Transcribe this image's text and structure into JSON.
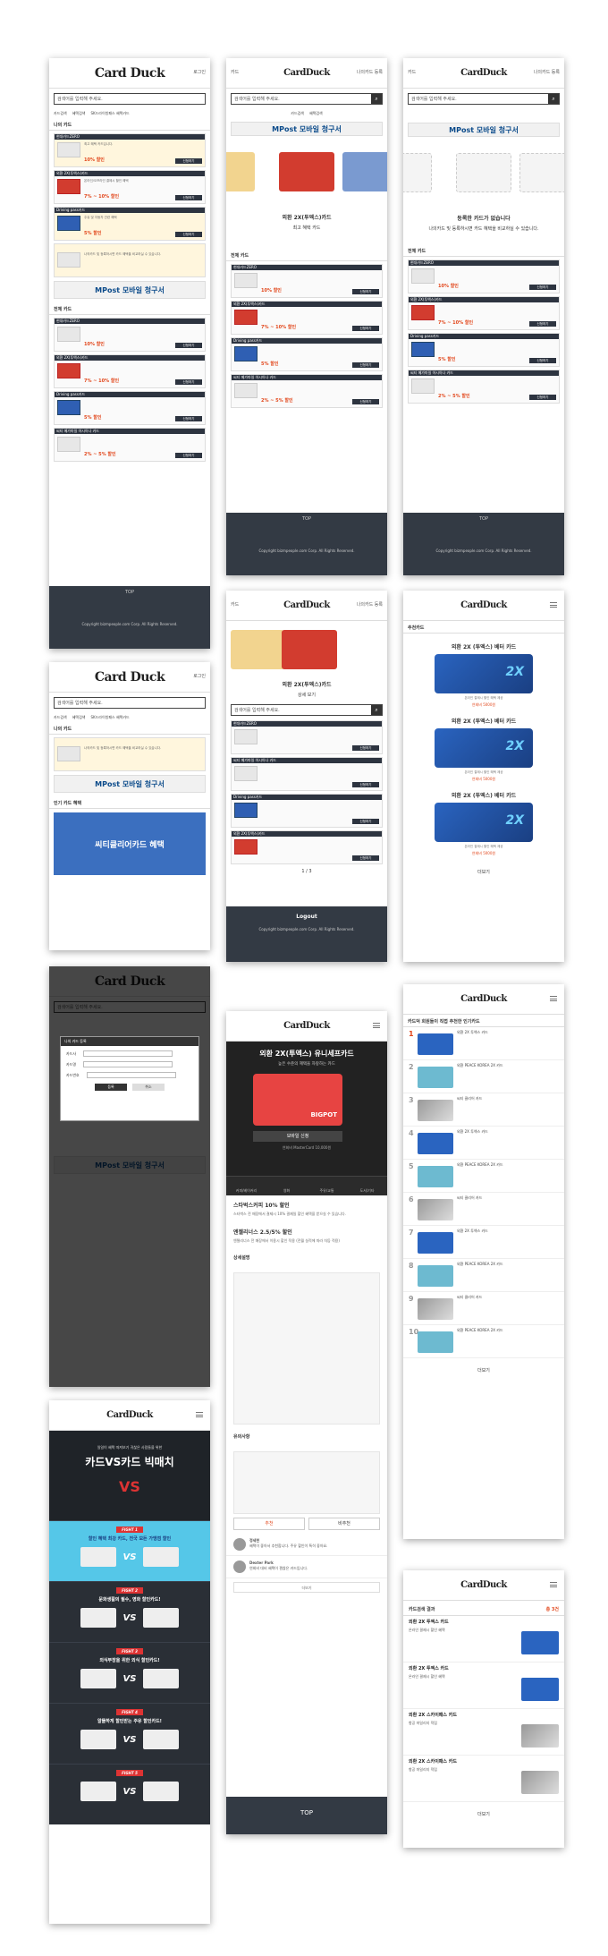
{
  "brand": {
    "logo": "Card Duck",
    "logo_small": "CardDuck"
  },
  "header": {
    "login": "로그인",
    "nav_left": "카드",
    "nav_right": "나의카드 등록"
  },
  "search": {
    "placeholder": "검색어를 입력해 주세요."
  },
  "chips": [
    "카드검색",
    "혜택검색",
    "SK드라이빙패스 혜택카드"
  ],
  "sections": {
    "my_card": "나의 카드",
    "all_card": "전체 카드",
    "popular_benefit": "인기 카드 혜택",
    "registered": "등록한 카드가 없습니다",
    "add_desc": "나의카드 및 등록하시면 카드 혜택을 비교하실 수 있습니다."
  },
  "cards": [
    {
      "bar": "현대카드ZERO",
      "desc": "최고 혜택 카드입니다.",
      "discount": "10% 할인",
      "apply": "신청하기"
    },
    {
      "bar": "외환 2X(투엑스)카드",
      "desc": "온라인/오프라인 결제시 할인 혜택",
      "discount": "7% ~ 10% 할인",
      "apply": "신청하기"
    },
    {
      "bar": "Driving pass카드",
      "desc": "주유 및 자동차 관련 혜택",
      "discount": "5% 할인",
      "apply": "신청하기"
    },
    {
      "bar": "씨티 메가마일 아시아나 카드",
      "desc": "아시아나 클럽 마일 적립",
      "discount": "2% ~ 5% 할인",
      "apply": "신청하기"
    }
  ],
  "banner": {
    "text": "MPost 모바일 청구서",
    "promo": "씨티클리어카드 혜택"
  },
  "footer": {
    "top": "TOP",
    "copy": "Copyright bizmpeople.com Corp. All Rights Reserved.",
    "logout": "Logout"
  },
  "slider": {
    "card_name": "외환 2X(투엑스)카드",
    "card_sub": "최고 혜택 카드",
    "page": "1 / 3",
    "detail_btn": "상세 보기"
  },
  "modal": {
    "title": "나의 카드 등록",
    "fields": [
      "카드사",
      "카드명",
      "카드번호"
    ],
    "ok": "등록",
    "cancel": "취소"
  },
  "recommend": {
    "section": "추천카드",
    "items": [
      {
        "title": "외환 2X (투엑스) 베터 카드",
        "desc": "온라인 결제시 할인 혜택 제공",
        "price": "연회비 5000원"
      },
      {
        "title": "외환 2X (투엑스) 베터 카드",
        "desc": "온라인 결제시 할인 혜택 제공",
        "price": "연회비 5000원"
      },
      {
        "title": "외환 2X (투엑스) 베터 카드",
        "desc": "온라인 결제시 할인 혜택 제공",
        "price": "연회비 5000원"
      }
    ],
    "more": "더보기"
  },
  "ranking": {
    "title": "카드덕 회원들이 직접 추천한 인기카드",
    "items": [
      {
        "n": "1",
        "name": "외환 2X 투엑스 카드",
        "tone": "b"
      },
      {
        "n": "2",
        "name": "외환 PEACE KOREA 2X 카드",
        "tone": "g"
      },
      {
        "n": "3",
        "name": "씨티 클리어 카드",
        "tone": "c"
      },
      {
        "n": "4",
        "name": "외환 2X 투엑스 카드",
        "tone": "b"
      },
      {
        "n": "5",
        "name": "외환 PEACE KOREA 2X 카드",
        "tone": "g"
      },
      {
        "n": "6",
        "name": "씨티 클리어 카드",
        "tone": "c"
      },
      {
        "n": "7",
        "name": "외환 2X 투엑스 카드",
        "tone": "b"
      },
      {
        "n": "8",
        "name": "외환 PEACE KOREA 2X 카드",
        "tone": "g"
      },
      {
        "n": "9",
        "name": "씨티 클리어 카드",
        "tone": "c"
      },
      {
        "n": "10",
        "name": "외환 PEACE KOREA 2X 카드",
        "tone": "g"
      }
    ],
    "more": "더보기"
  },
  "detail": {
    "title": "외환 2X(투엑스) 유니세프카드",
    "sub": "높은 수준의 혜택을 자랑하는 카드",
    "apply": "모바일 신청",
    "fee": "연회비 MasterCard 10,000원",
    "tabs": [
      "커피/베이커리",
      "영화",
      "주유/교통",
      "도서/기타"
    ],
    "b1_t": "스타벅스커피 10% 할인",
    "b1_d": "스타벅스 전 매장에서 결제시 10% 결제일 할인 혜택을 받으실 수 있습니다.",
    "b2_t": "엔젤리너스 2.5/5% 할인",
    "b2_d": "엔젤리너스 전 매장에서 이용시 할인 적용 (전월 실적에 따라 차등 적용)",
    "notice_t": "상세설명",
    "caution_t": "유의사항",
    "recommend": "추천",
    "unrecommend": "비추천",
    "c1_name": "정세현",
    "c1_text": "혜택이 좋아서 추천합니다. 주유 할인이 특히 좋아요.",
    "c2_name": "Dexter Park",
    "c2_text": "연회비 대비 혜택이 괜찮은 카드입니다.",
    "more": "더보기",
    "top": "TOP"
  },
  "vs": {
    "small": "일일이 혜택 따져보기 귀찮은 사람들을 위한",
    "big": "카드VS카드 빅매치",
    "vs": "VS",
    "fights": [
      {
        "badge": "FIGHT 1",
        "t": "할인 혜택 최강 카드, 전국 모든 가맹점 할인"
      },
      {
        "badge": "FIGHT 2",
        "t": "문화생활의 필수, 영화 할인카드!"
      },
      {
        "badge": "FIGHT 3",
        "t": "외식부장을 위한 외식 할인카드!"
      },
      {
        "badge": "FIGHT 4",
        "t": "알뜰하게 할인받는 주유 할인카드!"
      },
      {
        "badge": "FIGHT 5",
        "t": ""
      }
    ]
  },
  "results": {
    "title": "카드검색 결과",
    "count": "총 3건",
    "items": [
      {
        "name": "외환 2X 투엑스 카드",
        "desc": "온라인 결제시 할인 혜택"
      },
      {
        "name": "외환 2X 투엑스 카드",
        "desc": "온라인 결제시 할인 혜택"
      },
      {
        "name": "외환 2X 스카이패스 카드",
        "desc": "항공 마일리지 적립"
      },
      {
        "name": "외환 2X 스카이패스 카드",
        "desc": "항공 마일리지 적립"
      }
    ],
    "more": "더보기"
  }
}
